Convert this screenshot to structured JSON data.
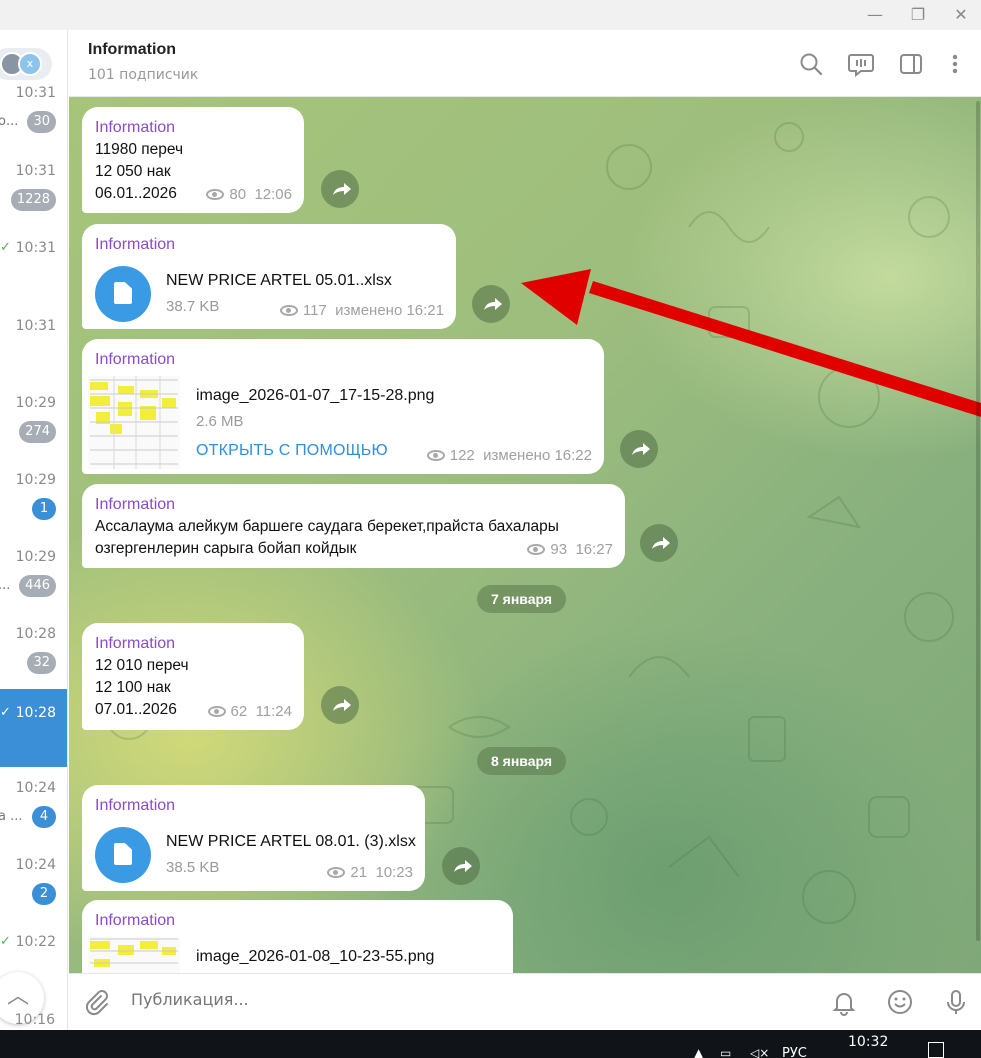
{
  "window": {
    "minimize": "—",
    "restore": "❐",
    "close": "✕"
  },
  "sidebar": {
    "top_avatar_letter": "x",
    "items": [
      {
        "time": "10:31",
        "snippet": "о...",
        "badge": "30",
        "badge_color": "grey",
        "checked": false,
        "active": false
      },
      {
        "time": "10:31",
        "snippet": "",
        "badge": "1228",
        "badge_color": "grey",
        "checked": false,
        "active": false
      },
      {
        "time": "10:31",
        "snippet": "",
        "badge": "",
        "badge_color": "",
        "checked": true,
        "active": false
      },
      {
        "time": "10:31",
        "snippet": "",
        "badge": "",
        "badge_color": "",
        "checked": false,
        "active": false
      },
      {
        "time": "10:29",
        "snippet": "",
        "badge": "274",
        "badge_color": "grey",
        "checked": false,
        "active": false
      },
      {
        "time": "10:29",
        "snippet": "",
        "badge": "1",
        "badge_color": "blue",
        "checked": false,
        "active": false
      },
      {
        "time": "10:29",
        "snippet": "...",
        "badge": "446",
        "badge_color": "grey",
        "checked": false,
        "active": false
      },
      {
        "time": "10:28",
        "snippet": "",
        "badge": "32",
        "badge_color": "grey",
        "checked": false,
        "active": false
      },
      {
        "time": "10:28",
        "snippet": "",
        "badge": "",
        "badge_color": "",
        "checked": true,
        "active": true
      },
      {
        "time": "10:24",
        "snippet": "а ...",
        "badge": "4",
        "badge_color": "blue",
        "checked": false,
        "active": false
      },
      {
        "time": "10:24",
        "snippet": "",
        "badge": "2",
        "badge_color": "blue",
        "checked": false,
        "active": false
      },
      {
        "time": "10:22",
        "snippet": "",
        "badge": "",
        "badge_color": "",
        "checked": true,
        "active": false
      }
    ],
    "scroll_up_icon": "chevron-up-icon",
    "bottom_time": "10:16"
  },
  "header": {
    "title": "Information",
    "subtitle": "101 подписчик",
    "icons": [
      "search-icon",
      "live-chat-icon",
      "sidebar-toggle-icon",
      "more-vertical-icon"
    ]
  },
  "messages": [
    {
      "author": "Information",
      "lines": [
        "11980 переч",
        "12 050 нак",
        "06.01..2026"
      ],
      "views": "80",
      "time": "12:06"
    },
    {
      "author": "Information",
      "file_name": "NEW PRICE ARTEL 05.01..xlsx",
      "file_size": "38.7 KB",
      "views": "117",
      "time": "изменено 16:21"
    },
    {
      "author": "Information",
      "file_name": "image_2026-01-07_17-15-28.png",
      "file_size": "2.6 MB",
      "open_with": "ОТКРЫТЬ С ПОМОЩЬЮ",
      "views": "122",
      "time": "изменено 16:22"
    },
    {
      "author": "Information",
      "lines": [
        "Ассалаума алейкум баршеге саудага берекет,прайста бахалары",
        "озгергенлерин сарыга бойап койдык"
      ],
      "views": "93",
      "time": "16:27"
    },
    {
      "author": "Information",
      "lines": [
        "12 010 переч",
        "12 100 нак",
        "07.01..2026"
      ],
      "views": "62",
      "time": "11:24"
    },
    {
      "author": "Information",
      "file_name": "NEW PRICE ARTEL 08.01. (3).xlsx",
      "file_size": "38.5 KB",
      "views": "21",
      "time": "10:23"
    },
    {
      "author": "Information",
      "file_name": "image_2026-01-08_10-23-55.png"
    }
  ],
  "date_separators": [
    "7 января",
    "8 января"
  ],
  "composer": {
    "placeholder": "Публикация...",
    "icons": [
      "attach-icon",
      "notifications-icon",
      "emoji-icon",
      "microphone-icon"
    ]
  },
  "annotation": {
    "color": "#e00000"
  },
  "taskbar": {
    "time": "10:32",
    "lang": "РУС"
  },
  "colors": {
    "accent": "#3a8fd6",
    "author": "#8a4cc9",
    "file_icon": "#3a9be4",
    "link": "#2f8fdb"
  }
}
